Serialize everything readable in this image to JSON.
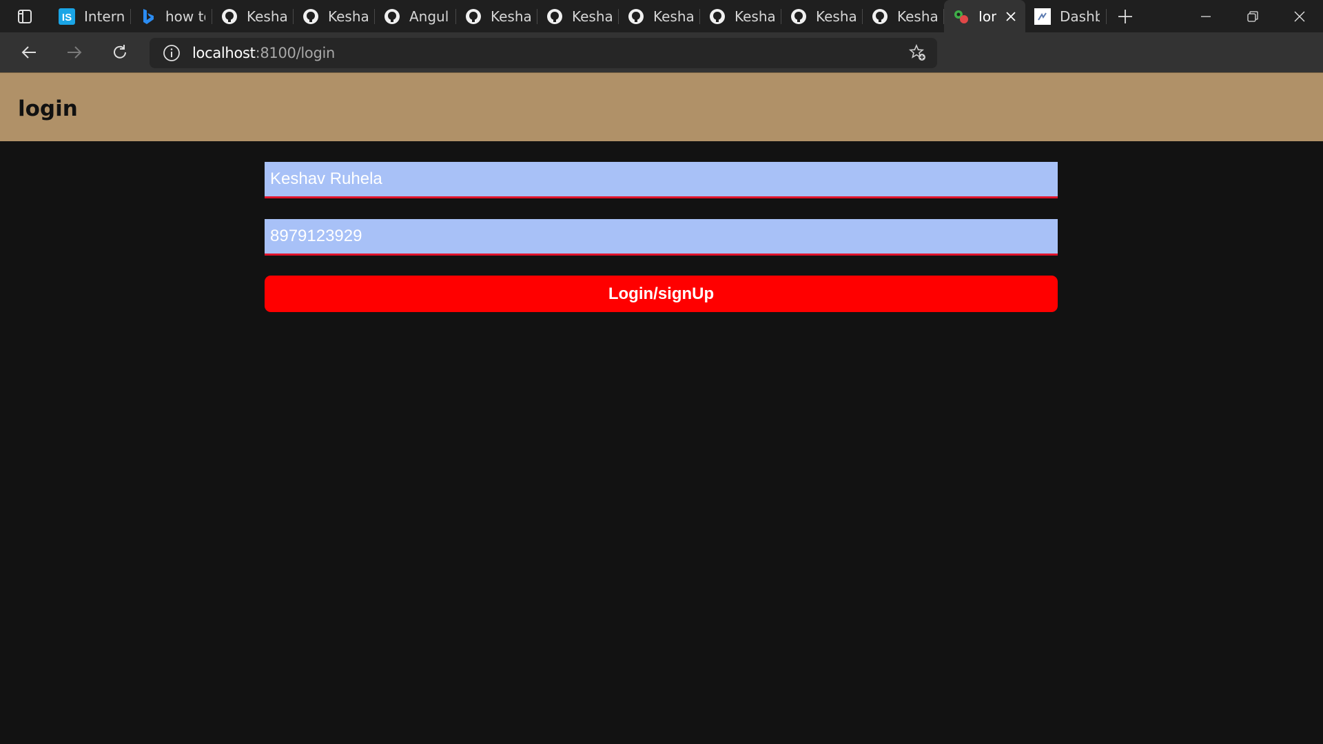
{
  "browser": {
    "tabs": [
      {
        "label": "Internsh",
        "icon": "internshala-icon"
      },
      {
        "label": "how to",
        "icon": "bing-icon"
      },
      {
        "label": "KeshavR",
        "icon": "github-icon"
      },
      {
        "label": "KeshavR",
        "icon": "github-icon"
      },
      {
        "label": "Angular",
        "icon": "github-icon"
      },
      {
        "label": "KeshavR",
        "icon": "github-icon"
      },
      {
        "label": "KeshavR",
        "icon": "github-icon"
      },
      {
        "label": "KeshavR",
        "icon": "github-icon"
      },
      {
        "label": "KeshavR",
        "icon": "github-icon"
      },
      {
        "label": "KeshavR",
        "icon": "github-icon"
      },
      {
        "label": "KeshavR",
        "icon": "github-icon"
      },
      {
        "label": "Ion",
        "icon": "ionic-icon",
        "active": true
      },
      {
        "label": "Dashbo",
        "icon": "dashboard-icon"
      }
    ],
    "address": {
      "host": "localhost",
      "path": ":8100/login"
    },
    "extensions": [
      "power-automate-icon",
      "ad-block-off-icon",
      "extensions-icon",
      "favorites-icon",
      "collections-icon",
      "history-icon",
      "profile-avatar",
      "more-icon"
    ]
  },
  "page": {
    "title": "login",
    "header_color": "#b09168",
    "name_value": "Keshav Ruhela",
    "phone_value": "8979123929",
    "submit_label": "Login/signUp",
    "accent": "#ff0000",
    "input_bg": "#a8c1f7"
  }
}
